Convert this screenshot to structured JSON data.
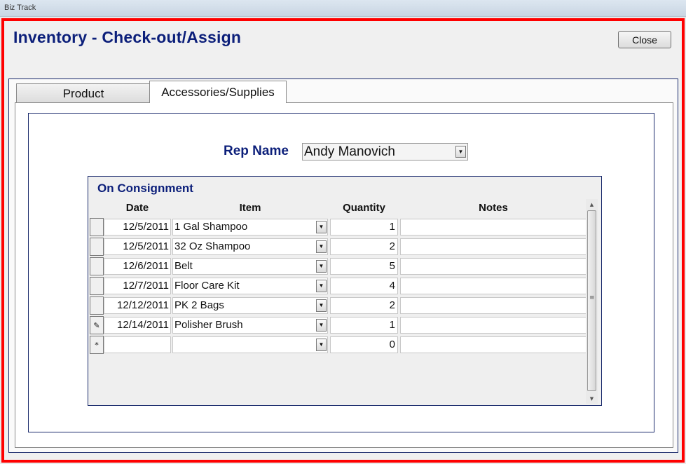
{
  "window": {
    "title": "Biz Track"
  },
  "form": {
    "title": "Inventory - Check-out/Assign",
    "close_label": "Close"
  },
  "tabs": [
    {
      "label": "Product",
      "active": false
    },
    {
      "label": "Accessories/Supplies",
      "active": true
    }
  ],
  "rep": {
    "label": "Rep Name",
    "value": "Andy Manovich"
  },
  "consignment": {
    "title": "On Consignment",
    "columns": [
      "Date",
      "Item",
      "Quantity",
      "Notes"
    ],
    "rows": [
      {
        "selector": "",
        "date": "12/5/2011",
        "item": "1 Gal Shampoo",
        "quantity": "1",
        "notes": ""
      },
      {
        "selector": "",
        "date": "12/5/2011",
        "item": "32 Oz Shampoo",
        "quantity": "2",
        "notes": ""
      },
      {
        "selector": "",
        "date": "12/6/2011",
        "item": "Belt",
        "quantity": "5",
        "notes": ""
      },
      {
        "selector": "",
        "date": "12/7/2011",
        "item": "Floor Care Kit",
        "quantity": "4",
        "notes": ""
      },
      {
        "selector": "",
        "date": "12/12/2011",
        "item": "PK 2 Bags",
        "quantity": "2",
        "notes": ""
      },
      {
        "selector": "✎",
        "date": "12/14/2011",
        "item": "Polisher Brush",
        "quantity": "1",
        "notes": ""
      },
      {
        "selector": "*",
        "date": "",
        "item": "",
        "quantity": "0",
        "notes": ""
      }
    ]
  },
  "icons": {
    "dropdown": "chevron-down-icon",
    "edit_row": "pencil-icon",
    "new_row": "asterisk-icon",
    "scroll_up": "arrow-up-icon",
    "scroll_down": "arrow-down-icon"
  },
  "colors": {
    "frame_border": "#ff0000",
    "heading": "#0c1f7a"
  }
}
